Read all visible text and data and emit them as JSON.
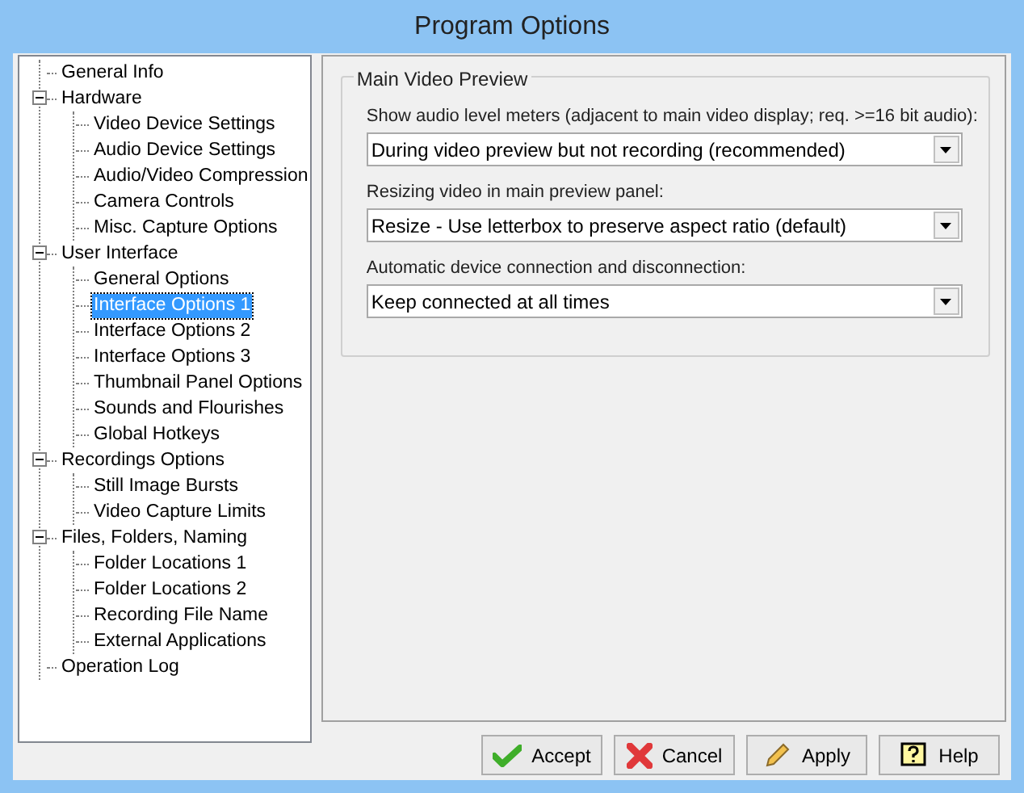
{
  "window": {
    "title": "Program Options"
  },
  "tree": [
    {
      "label": "General Info",
      "selected": false
    },
    {
      "label": "Hardware",
      "selected": false,
      "expanded": true,
      "children": [
        {
          "label": "Video Device Settings",
          "selected": false
        },
        {
          "label": "Audio Device Settings",
          "selected": false
        },
        {
          "label": "Audio/Video Compression",
          "selected": false
        },
        {
          "label": "Camera Controls",
          "selected": false
        },
        {
          "label": "Misc. Capture Options",
          "selected": false
        }
      ]
    },
    {
      "label": "User Interface",
      "selected": false,
      "expanded": true,
      "children": [
        {
          "label": "General Options",
          "selected": false
        },
        {
          "label": "Interface Options 1",
          "selected": true
        },
        {
          "label": "Interface Options 2",
          "selected": false
        },
        {
          "label": "Interface Options 3",
          "selected": false
        },
        {
          "label": "Thumbnail Panel Options",
          "selected": false
        },
        {
          "label": "Sounds and Flourishes",
          "selected": false
        },
        {
          "label": "Global Hotkeys",
          "selected": false
        }
      ]
    },
    {
      "label": "Recordings Options",
      "selected": false,
      "expanded": true,
      "children": [
        {
          "label": "Still Image Bursts",
          "selected": false
        },
        {
          "label": "Video Capture Limits",
          "selected": false
        }
      ]
    },
    {
      "label": "Files, Folders, Naming",
      "selected": false,
      "expanded": true,
      "children": [
        {
          "label": "Folder Locations 1",
          "selected": false
        },
        {
          "label": "Folder Locations 2",
          "selected": false
        },
        {
          "label": "Recording File Name",
          "selected": false
        },
        {
          "label": "External Applications",
          "selected": false
        }
      ]
    },
    {
      "label": "Operation Log",
      "selected": false
    }
  ],
  "group": {
    "title": "Main Video Preview",
    "fields": [
      {
        "label": "Show audio level meters (adjacent to main video display; req. >=16 bit audio):",
        "value": "During video preview but not recording (recommended)"
      },
      {
        "label": "Resizing video in main preview panel:",
        "value": "Resize - Use letterbox to preserve aspect ratio (default)"
      },
      {
        "label": "Automatic device connection and disconnection:",
        "value": "Keep connected at all times"
      }
    ]
  },
  "buttons": [
    {
      "label": "Accept",
      "kind": "accept"
    },
    {
      "label": "Cancel",
      "kind": "cancel"
    },
    {
      "label": "Apply",
      "kind": "apply"
    },
    {
      "label": "Help",
      "kind": "help"
    }
  ]
}
